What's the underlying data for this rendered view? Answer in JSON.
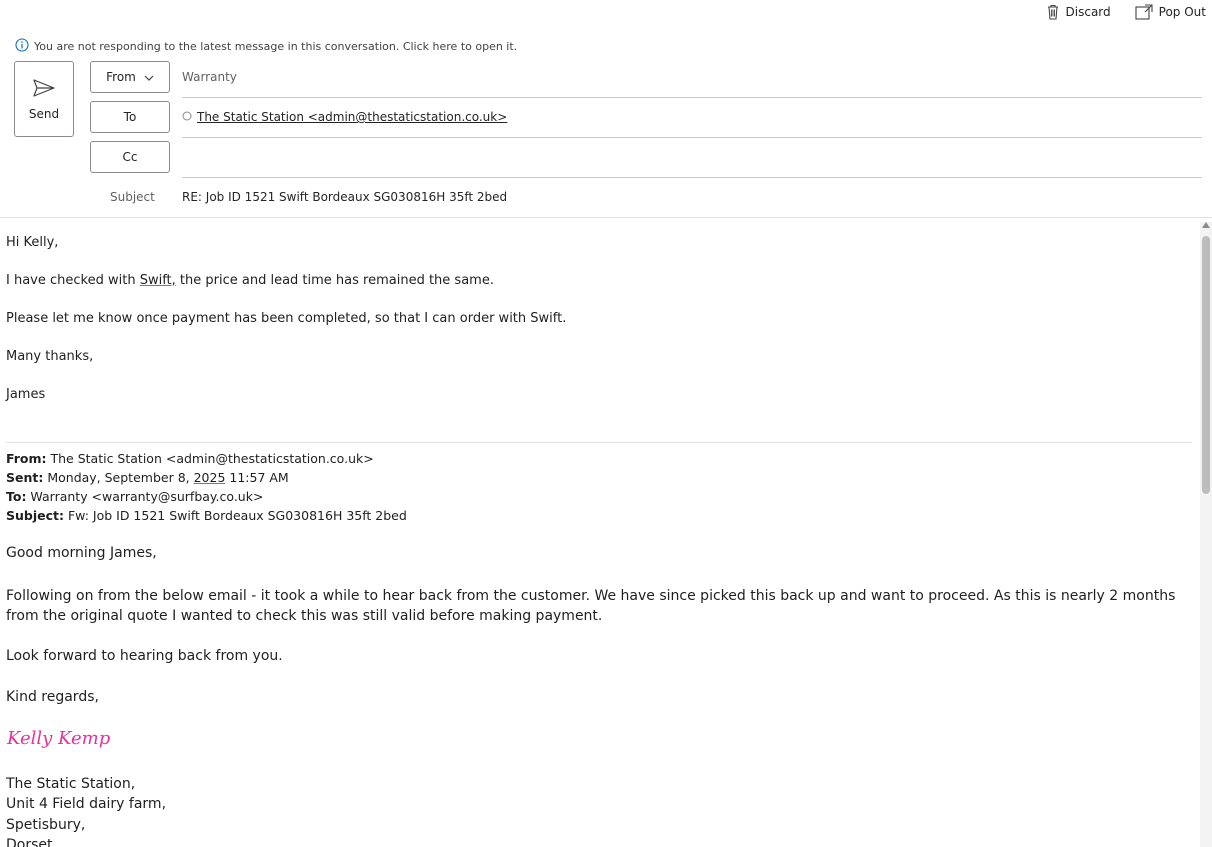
{
  "toolbar": {
    "discard_label": "Discard",
    "popout_label": "Pop Out"
  },
  "banner": {
    "text": "You are not responding to the latest message in this conversation. Click here to open it."
  },
  "compose": {
    "send_label": "Send",
    "from_label": "From",
    "from_value": "Warranty",
    "to_label": "To",
    "to_recipient": "The Static Station <admin@thestaticstation.co.uk>",
    "cc_label": "Cc",
    "subject_label": "Subject",
    "subject_value": "RE: Job ID 1521 Swift Bordeaux SG030816H 35ft 2bed"
  },
  "reply": {
    "greeting": "Hi Kelly,",
    "line1_a": "I have checked with ",
    "line1_b": "Swift,",
    "line1_c": " the price and lead time has remained the same.",
    "line2": "Please let me know once payment has been completed, so that I can order with Swift.",
    "closing": "Many thanks,",
    "name": "James"
  },
  "quoted": {
    "from_label": "From:",
    "from_value": " The Static Station <admin@thestaticstation.co.uk>",
    "sent_label": "Sent:",
    "sent_value_a": " Monday, September 8, ",
    "sent_value_year": "2025",
    "sent_value_b": " 11:57 AM",
    "to_label": "To:",
    "to_value": " Warranty <warranty@surfbay.co.uk>",
    "subject_label": "Subject:",
    "subject_value": " Fw: Job ID 1521 Swift Bordeaux SG030816H 35ft 2bed",
    "greeting": "Good morning James,",
    "paragraph": "Following on from the below email - it took a while to hear back from the customer. We have since picked this back up and want to proceed. As this is nearly 2 months from the original quote I wanted to check this was still valid before making payment.",
    "lookforward": "Look forward to hearing back from you.",
    "regards": "Kind regards,",
    "signature": "Kelly Kemp",
    "address": [
      "The Static Station,",
      "Unit 4 Field dairy farm,",
      "Spetisbury,",
      "Dorset"
    ]
  },
  "colors": {
    "signature": "#e6329c",
    "info_icon": "#0f6cbd",
    "spellcheck": "#2aa36c"
  }
}
